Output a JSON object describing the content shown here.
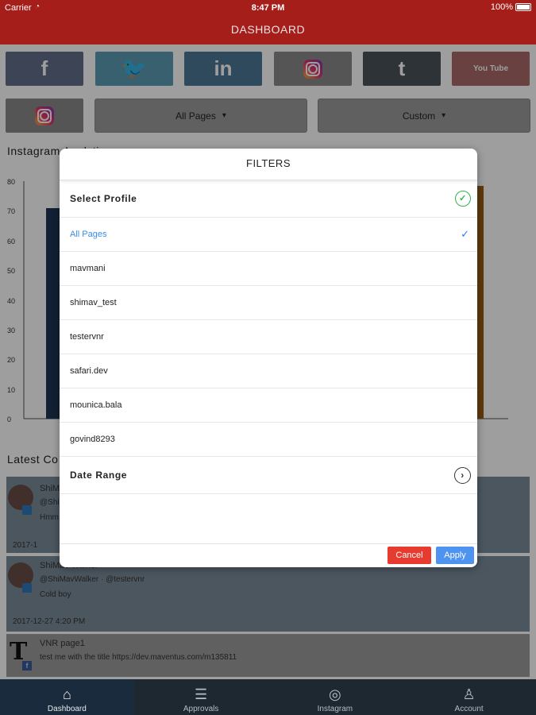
{
  "status": {
    "carrier": "Carrier",
    "time": "8:47 PM",
    "battery": "100%"
  },
  "header": {
    "title": "DASHBOARD"
  },
  "social": {
    "facebook": "f",
    "twitter": "🐦",
    "linkedin": "in",
    "tumblr": "t",
    "youtube": "You Tube"
  },
  "filters_bar": {
    "pages": "All Pages",
    "range": "Custom"
  },
  "background": {
    "analytics_title": "Instagram Analyti",
    "y_ticks": [
      "80",
      "70",
      "60",
      "50",
      "40",
      "30",
      "20",
      "10",
      "0"
    ],
    "latest_title": "Latest Co",
    "feed": [
      {
        "name": "ShiM",
        "handle": "@Shi",
        "text": "Hmm",
        "date": "2017-1"
      },
      {
        "name": "ShiMav Walker",
        "handle": "@ShiMavWalker · @testervnr",
        "text": "Cold boy",
        "date": "2017-12-27 4:20 PM"
      }
    ],
    "post": {
      "name": "VNR page1",
      "text": "test me with the title https://dev.maventus.com/m135811"
    }
  },
  "modal": {
    "title": "FILTERS",
    "select_profile": "Select Profile",
    "profiles": [
      "All Pages",
      "mavmani",
      "shimav_test",
      "testervnr",
      "safari.dev",
      "mounica.bala",
      "govind8293"
    ],
    "selected_profile": "All Pages",
    "date_range": "Date Range",
    "cancel": "Cancel",
    "apply": "Apply"
  },
  "tabs": [
    {
      "label": "Dashboard",
      "icon": "home-icon"
    },
    {
      "label": "Approvals",
      "icon": "list-icon"
    },
    {
      "label": "Instagram",
      "icon": "instagram-icon"
    },
    {
      "label": "Account",
      "icon": "person-icon"
    }
  ]
}
